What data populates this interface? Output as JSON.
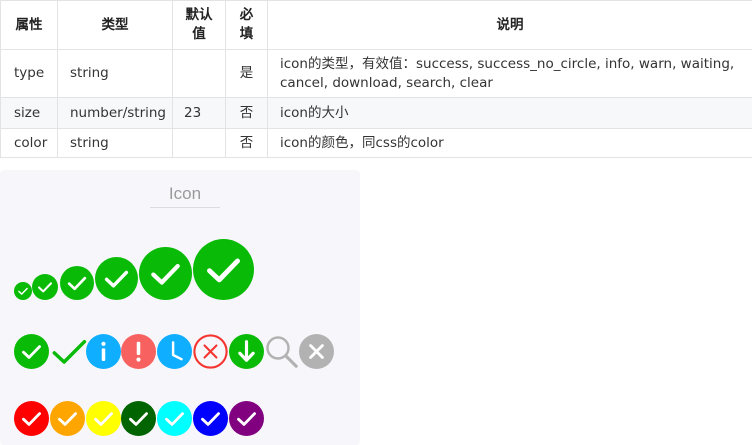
{
  "table": {
    "headers": {
      "name": "属性",
      "type": "类型",
      "default": "默认值",
      "required": "必填",
      "description": "说明"
    },
    "rows": [
      {
        "name": "type",
        "type": "string",
        "default": "",
        "required": "是",
        "description": "icon的类型，有效值：success, success_no_circle, info, warn, waiting, cancel, download, search, clear"
      },
      {
        "name": "size",
        "type": "number/string",
        "default": "23",
        "required": "否",
        "description": "icon的大小"
      },
      {
        "name": "color",
        "type": "string",
        "default": "",
        "required": "否",
        "description": "icon的颜色，同css的color"
      }
    ]
  },
  "preview": {
    "title": "Icon",
    "size_row": {
      "icon": "success-icon",
      "color": "#09bb07",
      "sizes": [
        20,
        30,
        40,
        50,
        60,
        70
      ]
    },
    "type_row": [
      {
        "type": "success",
        "icon": "success-icon",
        "color": "#09bb07"
      },
      {
        "type": "success_no_circle",
        "icon": "checkmark-icon",
        "color": "#09bb07"
      },
      {
        "type": "info",
        "icon": "info-icon",
        "color": "#10aeff"
      },
      {
        "type": "warn",
        "icon": "warn-icon",
        "color": "#f76260"
      },
      {
        "type": "waiting",
        "icon": "clock-icon",
        "color": "#10aeff"
      },
      {
        "type": "cancel",
        "icon": "cancel-icon",
        "color": "#f43530"
      },
      {
        "type": "download",
        "icon": "download-icon",
        "color": "#09bb07"
      },
      {
        "type": "search",
        "icon": "search-icon",
        "color": "#b2b2b2"
      },
      {
        "type": "clear",
        "icon": "clear-icon",
        "color": "#b2b2b2"
      }
    ],
    "color_row": {
      "icon": "success-icon",
      "colors": [
        "#ff0000",
        "#ffa500",
        "#ffff00",
        "#006400",
        "#00ffff",
        "#0000ff",
        "#800080"
      ]
    }
  }
}
